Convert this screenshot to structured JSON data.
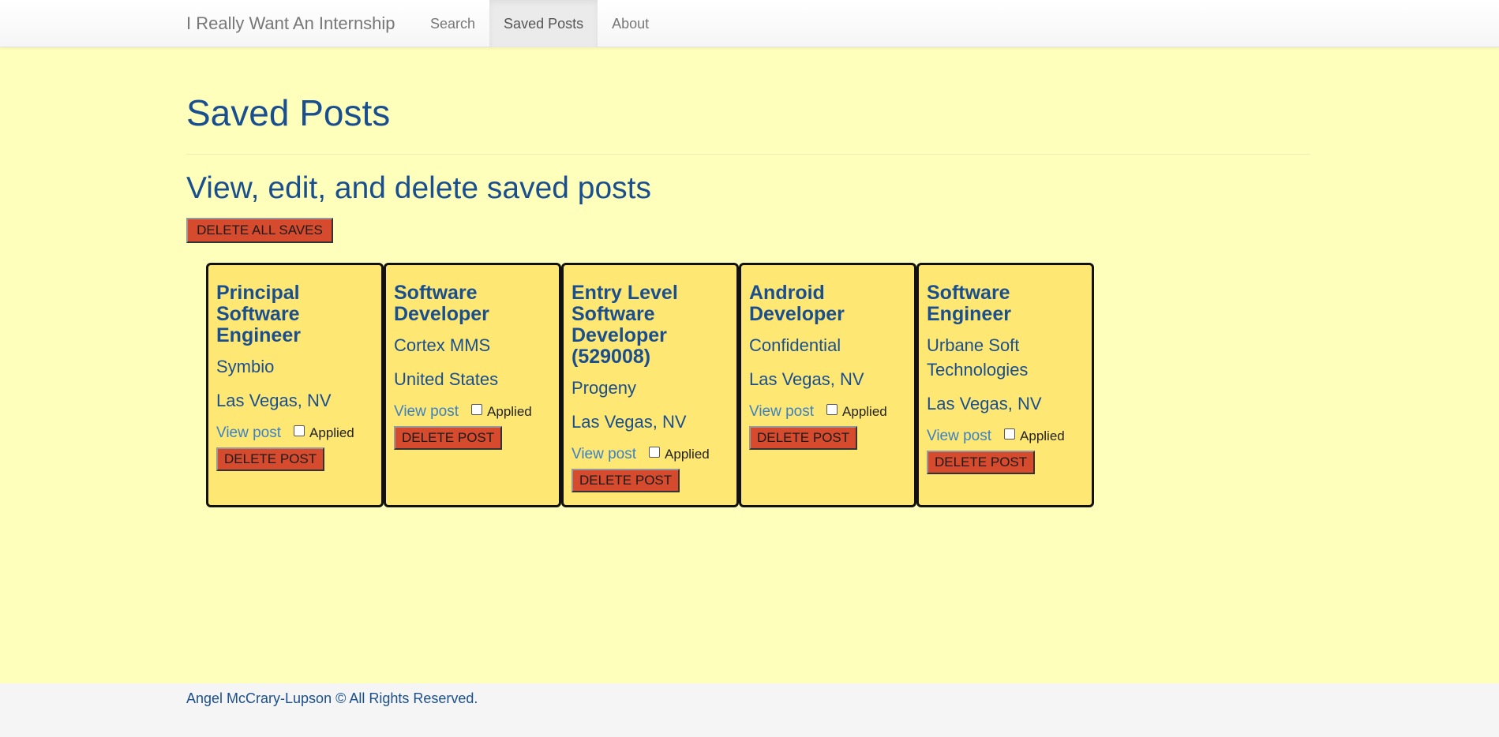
{
  "navbar": {
    "brand": "I Really Want An Internship",
    "items": [
      {
        "label": "Search",
        "active": false
      },
      {
        "label": "Saved Posts",
        "active": true
      },
      {
        "label": "About",
        "active": false
      }
    ]
  },
  "main": {
    "title": "Saved Posts",
    "subtitle": "View, edit, and delete saved posts",
    "delete_all_label": "DELETE ALL SAVES"
  },
  "cards": [
    {
      "title": "Principal Software Engineer",
      "company": "Symbio",
      "location": "Las Vegas, NV",
      "view_label": "View post",
      "applied_label": "Applied",
      "applied": false,
      "delete_label": "DELETE POST"
    },
    {
      "title": "Software Developer",
      "company": "Cortex MMS",
      "location": "United States",
      "view_label": "View post",
      "applied_label": "Applied",
      "applied": false,
      "delete_label": "DELETE POST"
    },
    {
      "title": "Entry Level Software Developer (529008)",
      "company": "Progeny",
      "location": "Las Vegas, NV",
      "view_label": "View post",
      "applied_label": "Applied",
      "applied": false,
      "delete_label": "DELETE POST"
    },
    {
      "title": "Android Developer",
      "company": "Confidential",
      "location": "Las Vegas, NV",
      "view_label": "View post",
      "applied_label": "Applied",
      "applied": false,
      "delete_label": "DELETE POST"
    },
    {
      "title": "Software Engineer",
      "company": "Urbane Soft Technologies",
      "location": "Las Vegas, NV",
      "view_label": "View post",
      "applied_label": "Applied",
      "applied": false,
      "delete_label": "DELETE POST"
    }
  ],
  "footer": {
    "text": "Angel McCrary-Lupson © All Rights Reserved."
  },
  "colors": {
    "background": "#ffffbc",
    "card": "#ffe774",
    "heading": "#1a4f8f",
    "link": "#3b82c4",
    "danger_button": "#d64a2d"
  }
}
